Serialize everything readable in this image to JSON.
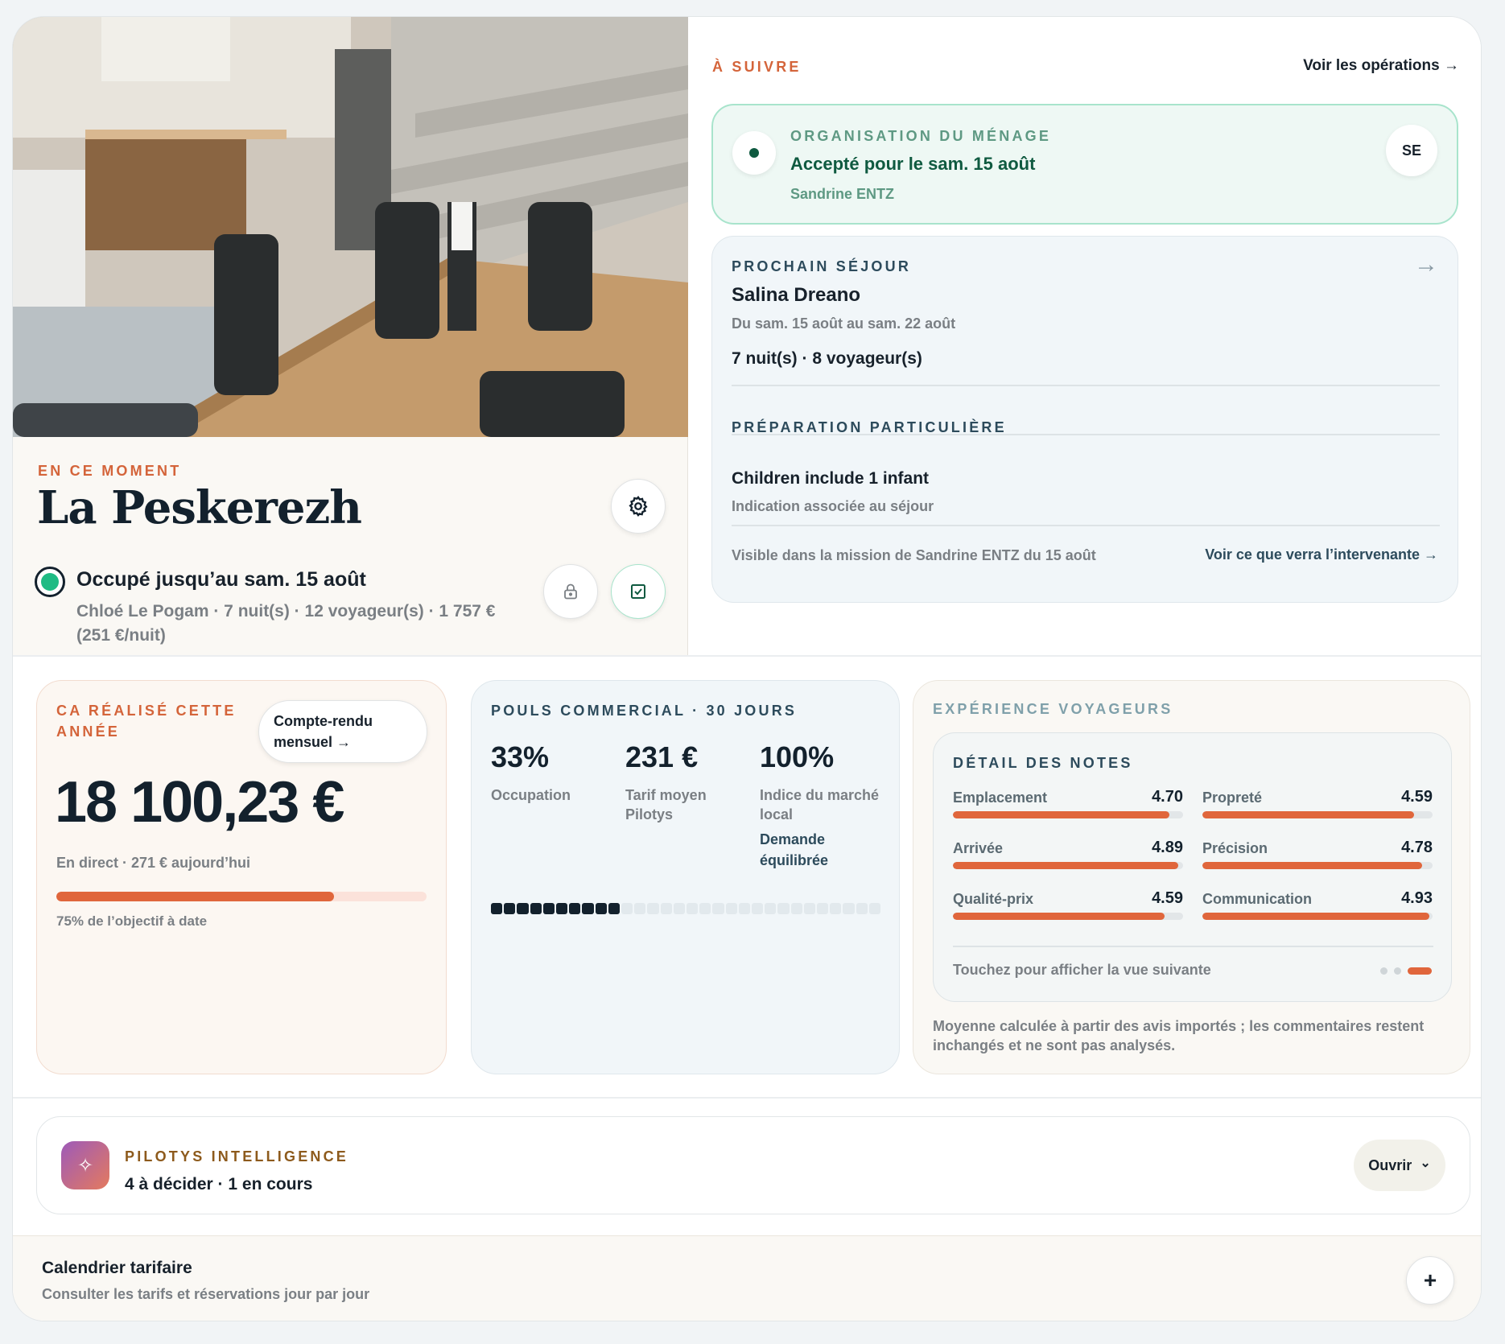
{
  "property": {
    "eyebrow": "EN CE MOMENT",
    "name": "La Peskerezh",
    "status_title": "Occupé jusqu’au sam. 15 août",
    "status_detail": "Chloé Le Pogam · 7 nuit(s) · 12 voyageur(s) · 1 757 € (251 €/nuit)",
    "photo_icon": "interior-photo",
    "settings_icon": "gear-icon",
    "lock_icon": "lock-icon",
    "check_icon": "checkbox-icon"
  },
  "upcoming": {
    "eyebrow": "À SUIVRE",
    "link": "Voir les opérations →",
    "cleaning": {
      "eyebrow": "ORGANISATION DU MÉNAGE",
      "title": "Accepté pour le sam. 15 août",
      "person": "Sandrine ENTZ",
      "initials": "SE"
    },
    "stay": {
      "eyebrow": "PROCHAIN SÉJOUR",
      "arrow": "→",
      "guest": "Salina Dreano",
      "dates": "Du sam. 15 août au sam. 22 août",
      "summary": "7 nuit(s) · 8 voyageur(s)",
      "prep_eyebrow": "PRÉPARATION PARTICULIÈRE",
      "prep_title": "Children include 1 infant",
      "prep_note": "Indication associée au séjour",
      "visibility": "Visible dans la mission de Sandrine ENTZ du 15 août",
      "preview_link": "Voir ce que verra l’intervenante →"
    }
  },
  "revenue": {
    "eyebrow": "CA RÉALISÉ CETTE ANNÉE",
    "report_button": "Compte-rendu mensuel →",
    "value": "18 100,23 €",
    "live": "En direct · 271 € aujourd’hui",
    "progress": 0.75,
    "objective": "75% de l’objectif à date"
  },
  "pulse": {
    "eyebrow": "POULS COMMERCIAL · 30 JOURS",
    "stats": [
      {
        "value": "33%",
        "label": "Occupation"
      },
      {
        "value": "231 €",
        "label": "Tarif moyen Pilotys"
      },
      {
        "value": "100%",
        "label": "Indice du marché local",
        "detail": "Demande équilibrée"
      }
    ],
    "days_total": 30,
    "days_booked": 10
  },
  "experience": {
    "eyebrow": "EXPÉRIENCE VOYAGEURS",
    "detail_title": "DÉTAIL DES NOTES",
    "scores": [
      {
        "label": "Emplacement",
        "value": "4.70"
      },
      {
        "label": "Propreté",
        "value": "4.59"
      },
      {
        "label": "Arrivée",
        "value": "4.89"
      },
      {
        "label": "Précision",
        "value": "4.78"
      },
      {
        "label": "Qualité-prix",
        "value": "4.59"
      },
      {
        "label": "Communication",
        "value": "4.93"
      }
    ],
    "touch_hint": "Touchez pour afficher la vue suivante",
    "note": "Moyenne calculée à partir des avis importés ; les commentaires restent inchangés et ne sont pas analysés."
  },
  "intelligence": {
    "eyebrow": "PILOTYS INTELLIGENCE",
    "summary": "4 à décider · 1 en cours",
    "open_button": "Ouvrir",
    "chevron": "⌄",
    "sparkle": "✧"
  },
  "calendar": {
    "title": "Calendrier tarifaire",
    "subtitle": "Consulter les tarifs et réservations jour par jour",
    "plus": "+"
  }
}
